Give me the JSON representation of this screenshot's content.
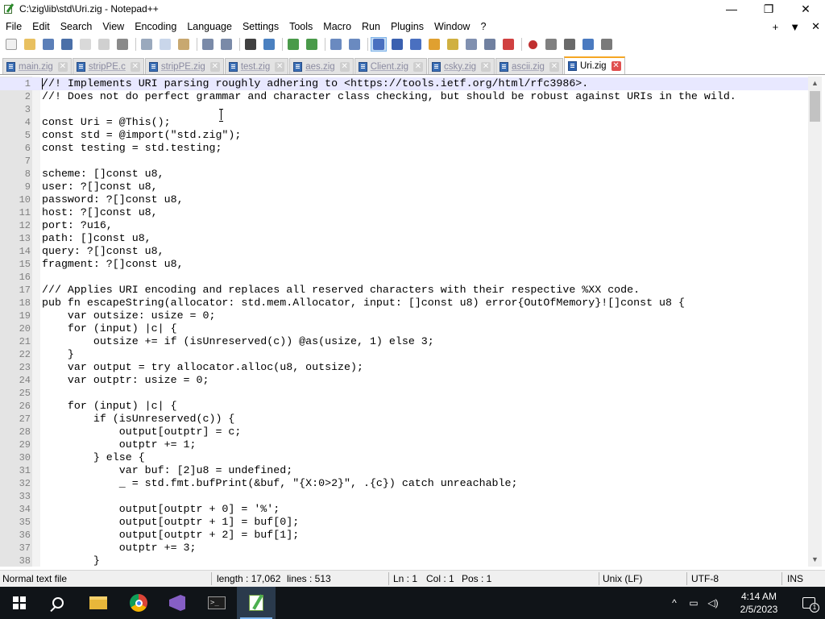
{
  "window": {
    "title": "C:\\zig\\lib\\std\\Uri.zig - Notepad++",
    "minimize": "—",
    "maximize": "❐",
    "close": "✕"
  },
  "menu": {
    "items": [
      "File",
      "Edit",
      "Search",
      "View",
      "Encoding",
      "Language",
      "Settings",
      "Tools",
      "Macro",
      "Run",
      "Plugins",
      "Window",
      "?"
    ],
    "right_plus": "+",
    "right_dropdown": "▼",
    "right_close": "✕"
  },
  "toolbar": {
    "buttons": [
      "new-file-icon",
      "open-file-icon",
      "save-icon",
      "save-all-icon",
      "close-icon",
      "close-all-icon",
      "print-icon",
      "cut-icon",
      "copy-icon",
      "paste-icon",
      "undo-icon",
      "redo-icon",
      "find-icon",
      "replace-icon",
      "zoom-in-icon",
      "zoom-out-icon",
      "sync-vertical-icon",
      "sync-horizontal-icon",
      "word-wrap-icon",
      "show-all-chars-icon",
      "indent-guide-icon",
      "document-map-icon",
      "function-list-icon",
      "folder-workspace-icon",
      "document-list-icon",
      "monitoring-icon",
      "record-macro-icon",
      "stop-record-icon",
      "play-macro-icon",
      "run-macro-multiple-icon",
      "save-macro-icon"
    ]
  },
  "tabs": [
    {
      "label": "main.zig",
      "active": false
    },
    {
      "label": "stripPE.c",
      "active": false
    },
    {
      "label": "stripPE.zig",
      "active": false
    },
    {
      "label": "test.zig",
      "active": false
    },
    {
      "label": "aes.zig",
      "active": false
    },
    {
      "label": "Client.zig",
      "active": false
    },
    {
      "label": "csky.zig",
      "active": false
    },
    {
      "label": "ascii.zig",
      "active": false
    },
    {
      "label": "Uri.zig",
      "active": true
    }
  ],
  "editor": {
    "lines": [
      "//! Implements URI parsing roughly adhering to <https://tools.ietf.org/html/rfc3986>.",
      "//! Does not do perfect grammar and character class checking, but should be robust against URIs in the wild.",
      "",
      "const Uri = @This();",
      "const std = @import(\"std.zig\");",
      "const testing = std.testing;",
      "",
      "scheme: []const u8,",
      "user: ?[]const u8,",
      "password: ?[]const u8,",
      "host: ?[]const u8,",
      "port: ?u16,",
      "path: []const u8,",
      "query: ?[]const u8,",
      "fragment: ?[]const u8,",
      "",
      "/// Applies URI encoding and replaces all reserved characters with their respective %XX code.",
      "pub fn escapeString(allocator: std.mem.Allocator, input: []const u8) error{OutOfMemory}![]const u8 {",
      "    var outsize: usize = 0;",
      "    for (input) |c| {",
      "        outsize += if (isUnreserved(c)) @as(usize, 1) else 3;",
      "    }",
      "    var output = try allocator.alloc(u8, outsize);",
      "    var outptr: usize = 0;",
      "",
      "    for (input) |c| {",
      "        if (isUnreserved(c)) {",
      "            output[outptr] = c;",
      "            outptr += 1;",
      "        } else {",
      "            var buf: [2]u8 = undefined;",
      "            _ = std.fmt.bufPrint(&buf, \"{X:0>2}\", .{c}) catch unreachable;",
      "",
      "            output[outptr + 0] = '%';",
      "            output[outptr + 1] = buf[0];",
      "            output[outptr + 2] = buf[1];",
      "            outptr += 3;",
      "        }"
    ],
    "first_line_number": 1
  },
  "scrollbar": {
    "up_arrow": "▲",
    "down_arrow": "▼"
  },
  "status": {
    "file_type": "Normal text file",
    "length": "length : 17,062",
    "lines": "lines : 513",
    "ln": "Ln : 1",
    "col": "Col : 1",
    "pos": "Pos : 1",
    "eol": "Unix (LF)",
    "encoding": "UTF-8",
    "mode": "INS"
  },
  "taskbar": {
    "apps": [
      "start-icon",
      "search-icon",
      "file-explorer-icon",
      "chrome-icon",
      "visual-studio-icon",
      "terminal-icon",
      "notepad-plus-plus-icon"
    ],
    "active_app": "notepad-plus-plus-icon",
    "clock_time": "4:14 AM",
    "clock_date": "2/5/2023",
    "tray_chevron": "^",
    "notification_count": "1"
  },
  "colors": {
    "current_line": "#e8e8ff",
    "active_tab_accent": "#f5a623",
    "gutter_bg": "#e4e4e4",
    "taskbar_bg": "#101418"
  }
}
